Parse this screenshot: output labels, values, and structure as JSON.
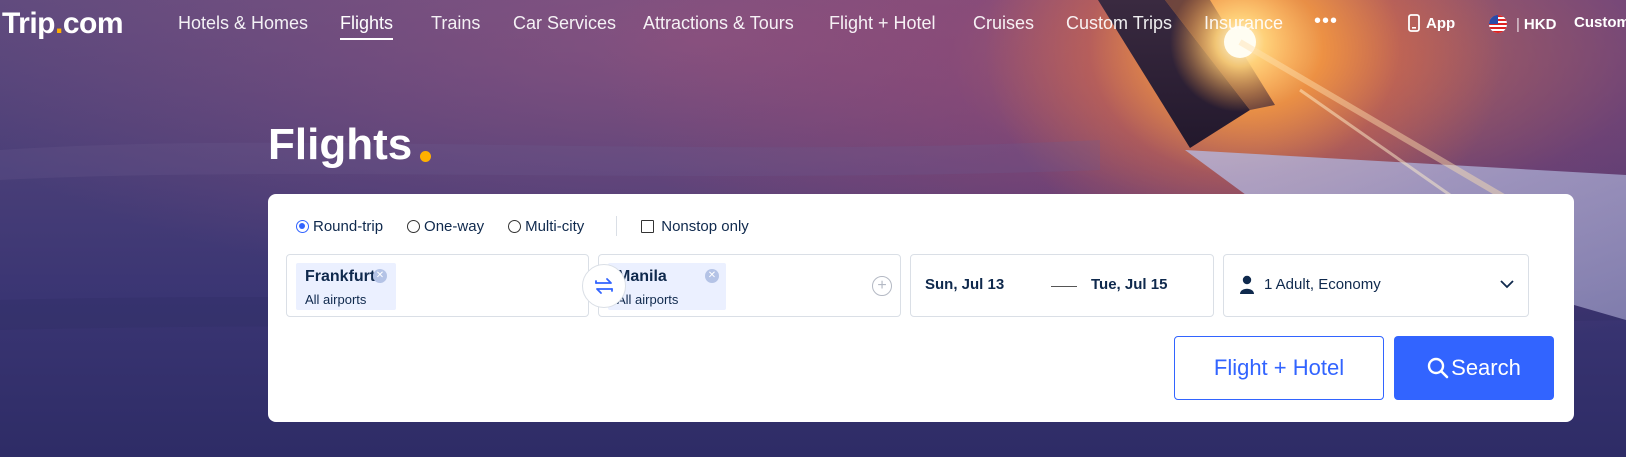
{
  "nav": {
    "logo_main": "Trip",
    "logo_dot": ".",
    "logo_tail": "com",
    "items": [
      {
        "label": "Hotels & Homes"
      },
      {
        "label": "Flights"
      },
      {
        "label": "Trains"
      },
      {
        "label": "Car Services"
      },
      {
        "label": "Attractions & Tours"
      },
      {
        "label": "Flight + Hotel"
      },
      {
        "label": "Cruises"
      },
      {
        "label": "Custom Trips"
      },
      {
        "label": "Insurance"
      }
    ],
    "active": "Flights",
    "more": "•••",
    "app_label": "App",
    "currency": "HKD",
    "customer": "Custom"
  },
  "hero": {
    "title": "Flights"
  },
  "search": {
    "trip_types": [
      {
        "label": "Round-trip",
        "selected": true
      },
      {
        "label": "One-way",
        "selected": false
      },
      {
        "label": "Multi-city",
        "selected": false
      }
    ],
    "nonstop_label": "Nonstop only",
    "nonstop_checked": false,
    "origin": {
      "city": "Frankfurt",
      "sub": "All airports"
    },
    "destination": {
      "city": "Manila",
      "sub": "All airports"
    },
    "depart_date": "Sun, Jul 13",
    "return_date": "Tue, Jul 15",
    "passengers": "1 Adult, Economy",
    "flight_hotel_label": "Flight + Hotel",
    "search_label": "Search"
  },
  "colors": {
    "accent": "#3264ff",
    "brand_dot": "#ffb000",
    "text_dark": "#0f294d",
    "chip_bg": "#ebf0ff"
  }
}
